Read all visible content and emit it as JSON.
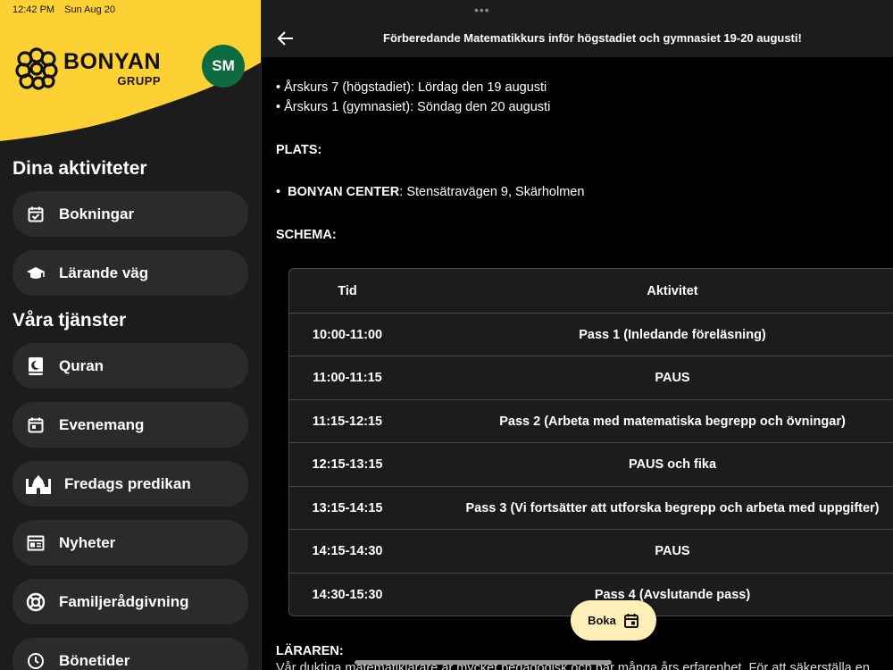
{
  "status_bar": {
    "time": "12:42 PM",
    "date": "Sun Aug 20"
  },
  "brand": {
    "name": "BONYAN",
    "sub": "GRUPP",
    "color": "#fdd034"
  },
  "avatar": {
    "initials": "SM",
    "color": "#0d6b3f"
  },
  "sidebar": {
    "section1_title": "Dina aktiviteter",
    "section1_items": [
      {
        "label": "Bokningar",
        "icon": "calendar-check-icon"
      },
      {
        "label": "Lärande väg",
        "icon": "graduation-cap-icon"
      }
    ],
    "section2_title": "Våra tjänster",
    "section2_items": [
      {
        "label": "Quran",
        "icon": "quran-book-icon"
      },
      {
        "label": "Evenemang",
        "icon": "calendar-event-icon"
      },
      {
        "label": "Fredags predikan",
        "icon": "mosque-icon"
      },
      {
        "label": "Nyheter",
        "icon": "newspaper-icon"
      },
      {
        "label": "Familjerådgivning",
        "icon": "lifebuoy-icon"
      },
      {
        "label": "Bönetider",
        "icon": "clock-icon"
      }
    ]
  },
  "header": {
    "title": "Förberedande Matematikkurs inför högstadiet och gymnasiet 19-20 augusti!"
  },
  "content": {
    "dates": [
      "Årskurs 7 (högstadiet): Lördag den 19 augusti",
      "Årskurs 1 (gymnasiet): Söndag den 20 augusti"
    ],
    "place_heading": "PLATS:",
    "place_name": "BONYAN CENTER",
    "place_address": ": Stensätravägen 9, Skärholmen",
    "schedule_heading": "SCHEMA:",
    "schedule_headers": {
      "time": "Tid",
      "activity": "Aktivitet"
    },
    "schedule": [
      {
        "time": "10:00-11:00",
        "activity": "Pass 1 (Inledande föreläsning)"
      },
      {
        "time": "11:00-11:15",
        "activity": "PAUS"
      },
      {
        "time": "11:15-12:15",
        "activity": "Pass 2 (Arbeta med matematiska begrepp och övningar)"
      },
      {
        "time": "12:15-13:15",
        "activity": "PAUS och fika"
      },
      {
        "time": "13:15-14:15",
        "activity": "Pass 3 (Vi fortsätter att utforska begrepp och arbeta med uppgifter)"
      },
      {
        "time": "14:15-14:30",
        "activity": "PAUS"
      },
      {
        "time": "14:30-15:30",
        "activity": "Pass 4 (Avslutande pass)"
      }
    ],
    "teacher_heading": "LÄRAREN:",
    "teacher_text_cut": "Vår duktiga matematiklärare är mycket pedagogisk och har många års erfarenhet. För att säkerställa en"
  },
  "book_button": {
    "label": "Boka",
    "icon": "calendar-icon",
    "color": "#fdefb7"
  }
}
